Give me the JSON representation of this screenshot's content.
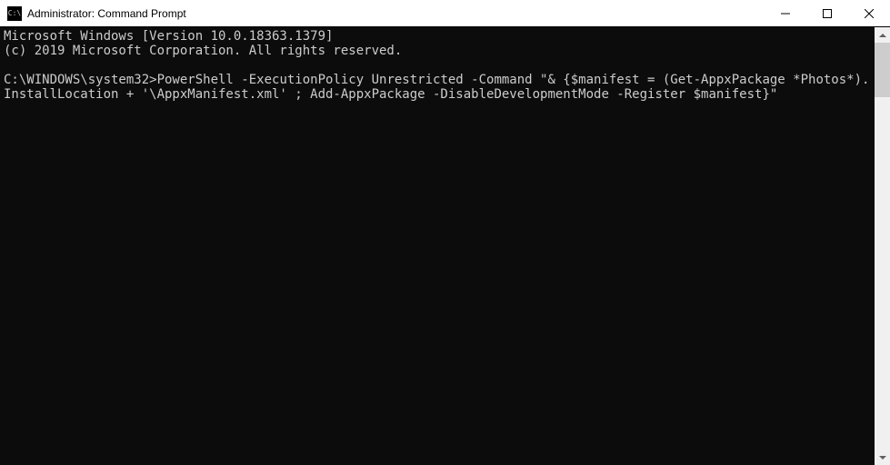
{
  "titlebar": {
    "icon_label": "C:\\",
    "title": "Administrator: Command Prompt"
  },
  "terminal": {
    "line1": "Microsoft Windows [Version 10.0.18363.1379]",
    "line2": "(c) 2019 Microsoft Corporation. All rights reserved.",
    "blank1": "",
    "prompt": "C:\\WINDOWS\\system32>",
    "command": "PowerShell -ExecutionPolicy Unrestricted -Command \"& {$manifest = (Get-AppxPackage *Photos*).InstallLocation + '\\AppxManifest.xml' ; Add-AppxPackage -DisableDevelopmentMode -Register $manifest}\""
  }
}
